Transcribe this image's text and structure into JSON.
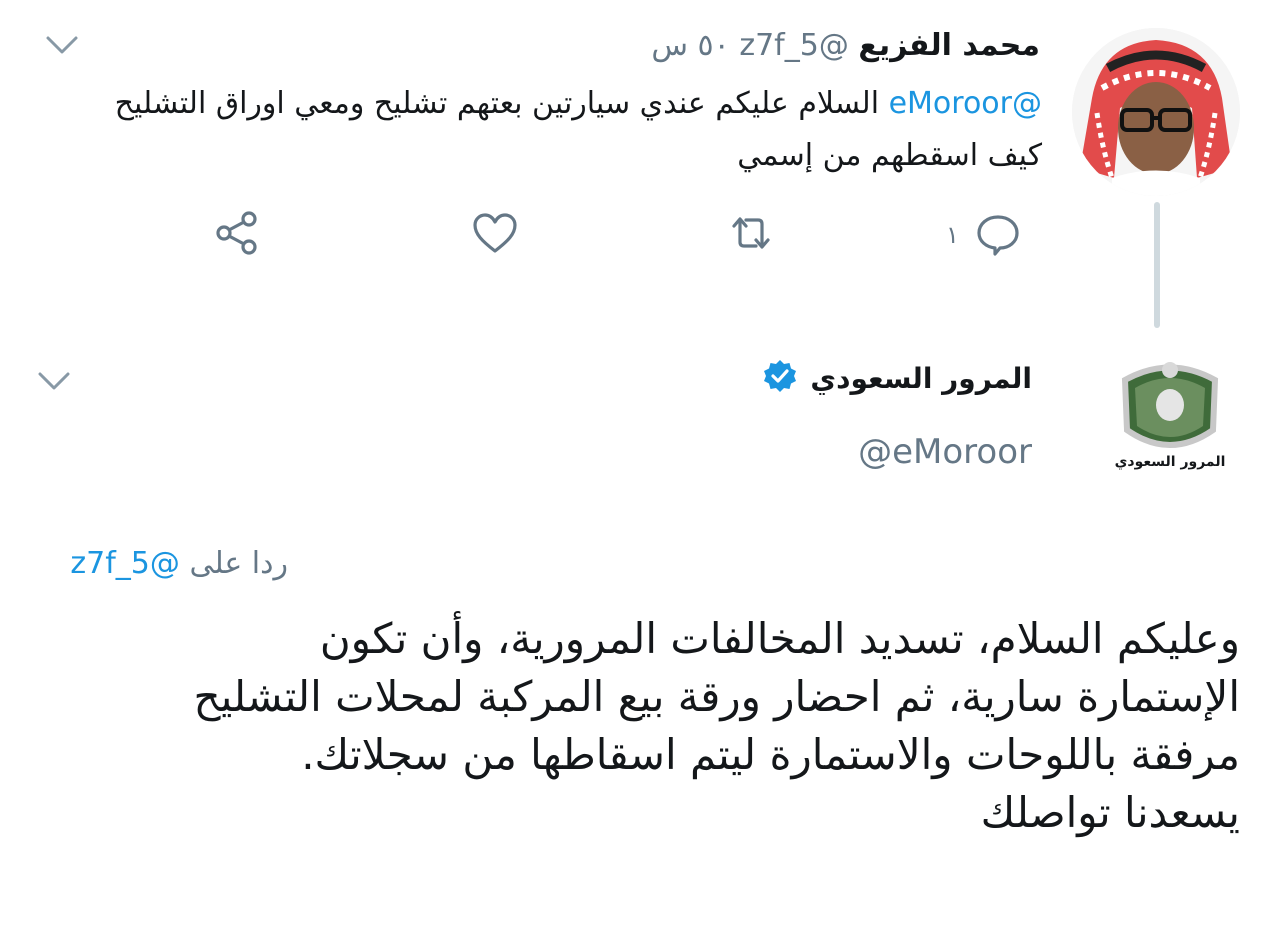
{
  "tweet1": {
    "name": "محمد الفزيع",
    "handle": "@z7f_5",
    "time": "٥٠ س",
    "mention": "@eMoroor",
    "text": "السلام عليكم عندي سيارتين بعتهم تشليح ومعي اوراق التشليح كيف اسقطهم من إسمي",
    "reply_count": "١"
  },
  "tweet2": {
    "name": "المرور السعودي",
    "handle": "@eMoroor",
    "avatar_caption": "المرور السعودي",
    "reply_label": "ردا على",
    "reply_to": "@z7f_5",
    "text": "وعليكم السلام، تسديد المخالفات المرورية، وأن تكون الإستمارة سارية، ثم احضار ورقة بيع المركبة لمحلات التشليح مرفقة باللوحات والاستمارة ليتم اسقاطها من سجلاتك. يسعدنا تواصلك"
  },
  "colors": {
    "accent": "#1b95e0",
    "muted": "#657786",
    "text": "#14171a"
  },
  "icons": [
    "chevron-down-icon",
    "reply-icon",
    "retweet-icon",
    "like-icon",
    "share-icon",
    "verified-badge-icon"
  ]
}
